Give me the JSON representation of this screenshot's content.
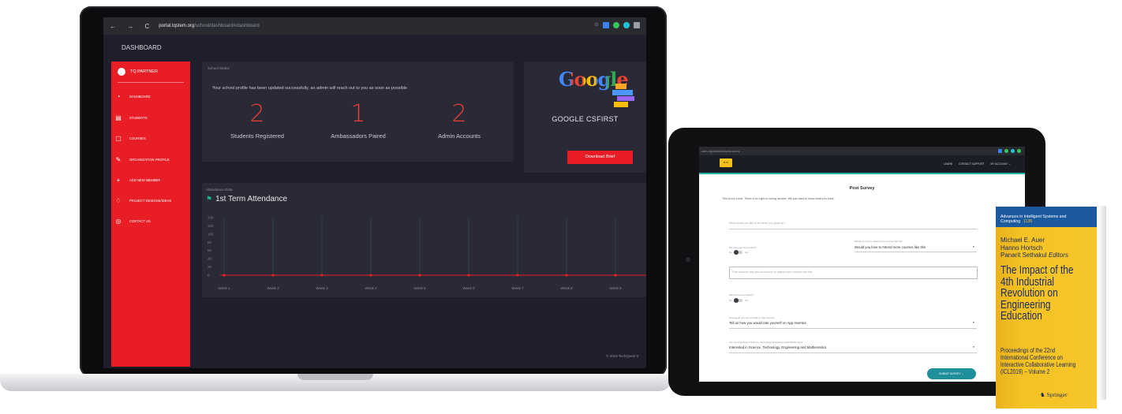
{
  "laptop": {
    "browser": {
      "nav_glyphs": "← → C",
      "url_host": "portal.tqstem.org",
      "url_path": "/school/dashboard#/dashboard"
    },
    "dashboard_header": "DASHBOARD",
    "sidebar": {
      "brand": "TQ PARTNER",
      "items": [
        {
          "label": "DASHBOARD",
          "icon": "dashboard-icon"
        },
        {
          "label": "STUDENTS",
          "icon": "clipboard-icon"
        },
        {
          "label": "COURSES",
          "icon": "courses-icon"
        },
        {
          "label": "ORGANIZATION PROFILE",
          "icon": "pencil-icon"
        },
        {
          "label": "ADD NEW MEMBER",
          "icon": "plus-icon"
        },
        {
          "label": "PROJECT DESIGNS/IDEAS",
          "icon": "bulb-icon"
        },
        {
          "label": "CONTACT US",
          "icon": "support-icon"
        }
      ]
    },
    "school_status": {
      "label": "School Status",
      "message": "Your school profile has been updated successfully, an admin will reach out to you as soon as possible",
      "stats": [
        {
          "value": "2",
          "caption": "Students Registered"
        },
        {
          "value": "1",
          "caption": "Ambassadors Paired"
        },
        {
          "value": "2",
          "caption": "Admin Accounts"
        }
      ]
    },
    "csfirst": {
      "logo_text": "Google",
      "title": "GOOGLE CSFIRST",
      "button": "Download Brief"
    },
    "attendance": {
      "label": "Attendance Data",
      "title": "1st Term Attendance"
    },
    "footer": "© 2019 TechQuest S"
  },
  "chart_data": {
    "type": "line",
    "title": "1st Term Attendance",
    "x": [
      "Week 1",
      "Week 2",
      "Week 3",
      "Week 4",
      "Week 5",
      "Week 6",
      "Week 7",
      "Week 8",
      "Week 9"
    ],
    "series": [
      {
        "values": [
          0,
          0,
          0,
          0,
          0,
          0,
          0,
          0,
          0
        ]
      }
    ],
    "yticks": [
      140,
      120,
      100,
      80,
      60,
      40,
      20,
      0
    ],
    "ylim": [
      0,
      140
    ],
    "grid": true,
    "colors": {
      "line": "#e81d25",
      "grid": "#2f4f5c"
    }
  },
  "tablet": {
    "url": "stem.org/dashboard/post-survey",
    "logo": "MTN",
    "nav_links": [
      "LEARN",
      "CONTACT SUPPORT",
      "MY ACCOUNT ⌄"
    ],
    "form_title": "Post Survey",
    "intro": "This is not a test. There is no right or wrong answer. We just want to know what you think.",
    "q_grow_placeholder": "What would you like to be when you grow up?",
    "q_enjoy_label": "Did you enjoy the Course?",
    "q_more_label": "Would you love to attend more courses like this",
    "q_more_value": "Would you love to Attend more courses like this",
    "q_reasons_placeholder": "Give reasons why you would love to attend more courses like this",
    "q_helpful_label": "Was the course helpful?",
    "toggle_no": "No",
    "toggle_yes": "Yes",
    "q_rate_label": "How would you rate yourself on App Inventor",
    "q_rate_value": "Tell us how you would rate yourself on App Inventor",
    "q_interest_label": "Are you interested in Science, Technology, Engineering and Mathematics",
    "q_interest_value": "Interested in Science, Technology, Engineering and Mathematics",
    "submit": "SUBMIT SURVEY →"
  },
  "book": {
    "series": "Advances in Intelligent Systems and Computing",
    "volume": "1135",
    "editors": [
      "Michael E. Auer",
      "Hanno Hortsch",
      "Panarit Sethakul"
    ],
    "editors_suffix": "Editors",
    "title": "The Impact of the 4th Industrial Revolution on Engineering Education",
    "subtitle": "Proceedings of the 22nd International Conference on Interactive Collaborative Learning (ICL2019) – Volume 2",
    "publisher": "Springer"
  },
  "colors": {
    "accent_red": "#e81d25",
    "stat_red": "#ea3d34",
    "dark_bg": "#1f1f2b",
    "card_bg": "#2a2a36",
    "teal": "#1fb6a8",
    "book_yellow": "#f5c223",
    "book_blue": "#1c5aa0"
  }
}
